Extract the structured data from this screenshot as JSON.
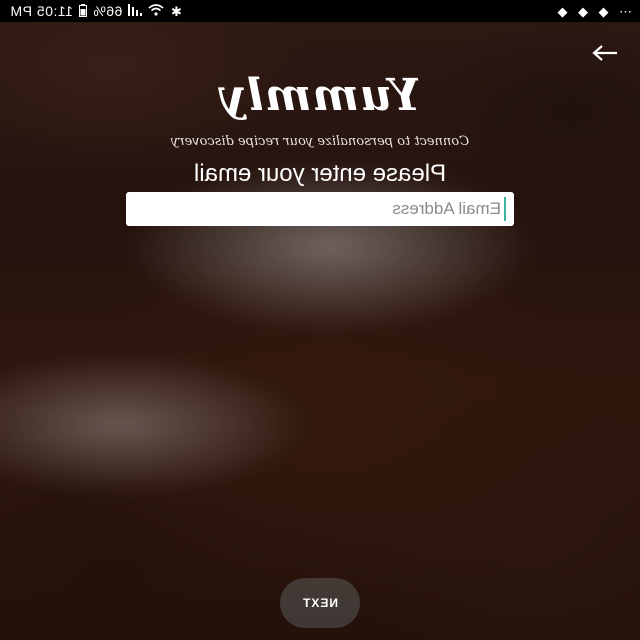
{
  "status_bar": {
    "time": "11:05 PM",
    "battery": "66%",
    "icons": [
      "signal-icon",
      "wifi-icon",
      "bluetooth-icon",
      "battery-icon",
      "more-icon",
      "notification-icon"
    ]
  },
  "header": {
    "forward_icon": "arrow-right-icon"
  },
  "brand": {
    "logo_text": "Yummly",
    "tagline": "Connect to personalize your recipe discovery"
  },
  "form": {
    "prompt": "Please enter your email",
    "email_placeholder": "Email Address",
    "caret_color": "#3bb3a0"
  },
  "footer": {
    "next_label": "NEXT"
  },
  "colors": {
    "field_background": "#ffffff",
    "status_bar": "#000000",
    "text": "#ffffff"
  }
}
